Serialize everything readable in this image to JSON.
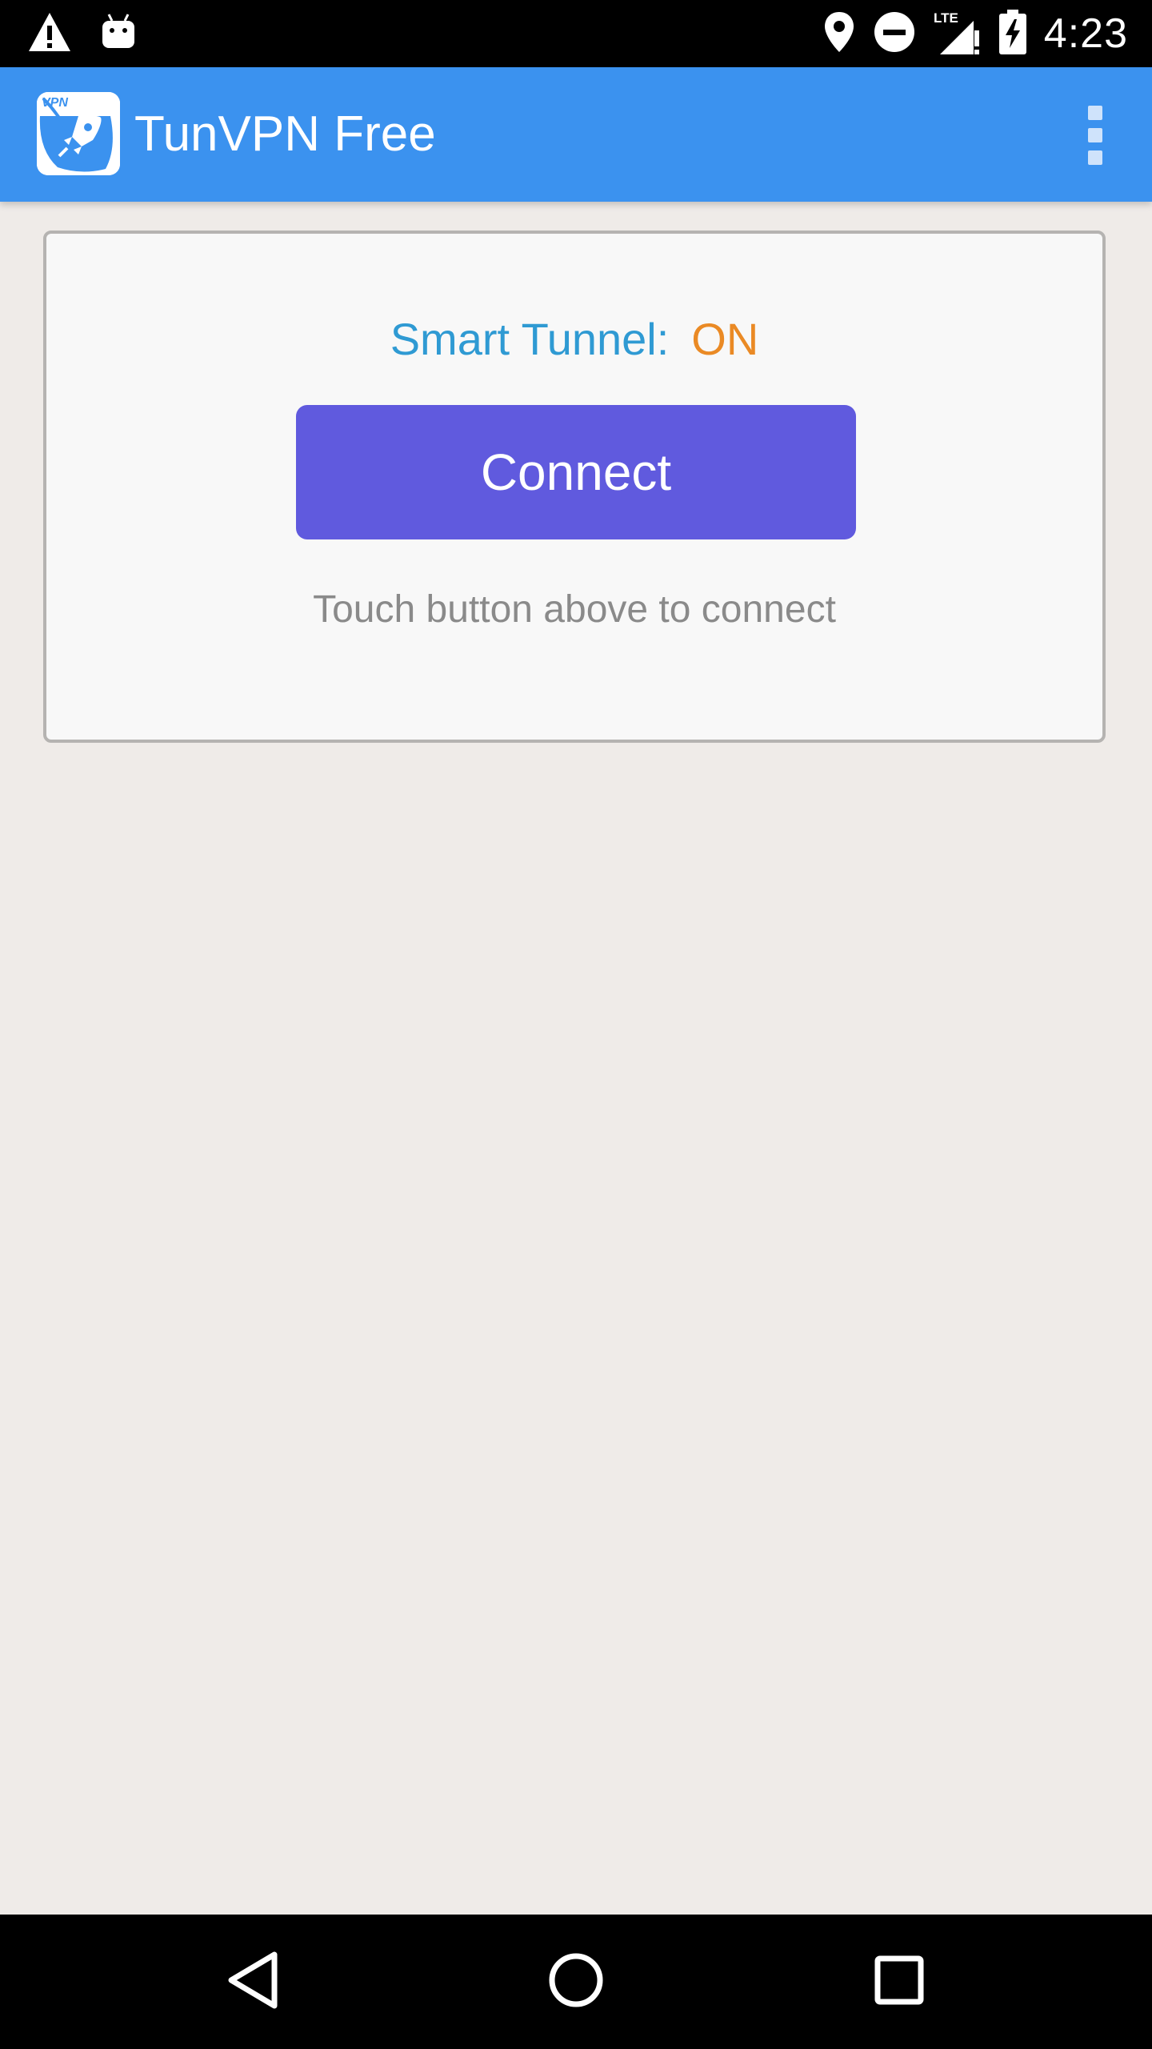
{
  "status_bar": {
    "time": "4:23",
    "left_icons": [
      "warning-icon",
      "android-icon"
    ],
    "right_icons": [
      "location-icon",
      "do-not-disturb-icon",
      "lte-signal-icon",
      "battery-charging-icon"
    ],
    "network_label": "LTE"
  },
  "toolbar": {
    "title": "TunVPN Free",
    "logo_text": "VPN",
    "background_color": "#3b92ef"
  },
  "card": {
    "smart_tunnel_label": "Smart Tunnel:",
    "smart_tunnel_value": "ON",
    "connect_label": "Connect",
    "hint": "Touch button above to connect",
    "label_color": "#2f9ad3",
    "value_color": "#ea8a25",
    "button_color": "#605ade"
  },
  "nav_bar": {
    "buttons": [
      "back-icon",
      "home-icon",
      "recents-icon"
    ]
  }
}
